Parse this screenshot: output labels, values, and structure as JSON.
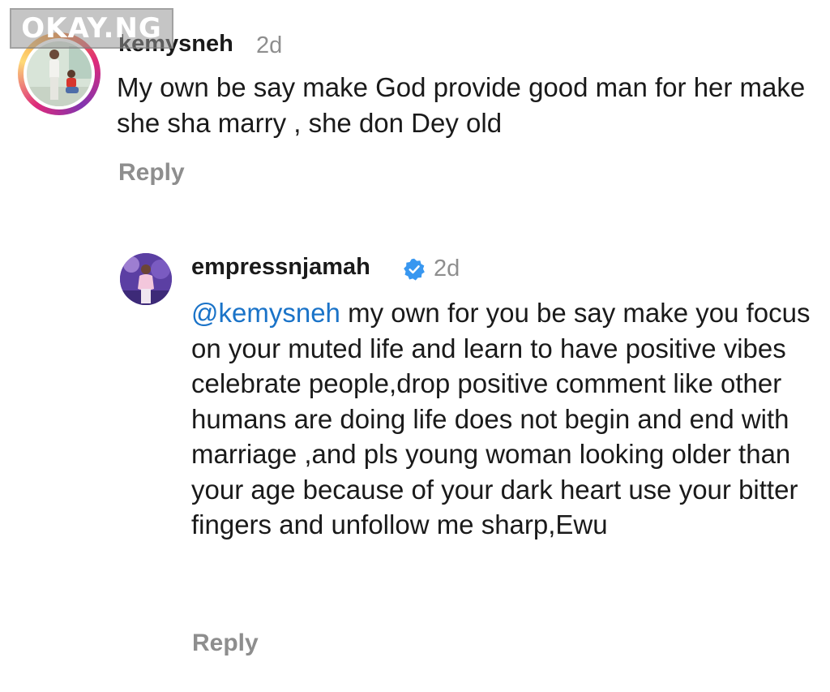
{
  "watermark": {
    "text": "OKAY.NG"
  },
  "comments": [
    {
      "username": "kemysneh",
      "time": "2d",
      "text": "My own be say make God provide good man for her make she sha marry , she don Dey old",
      "reply_label": "Reply"
    },
    {
      "username": "empressnjamah",
      "verified": true,
      "time": "2d",
      "mention": "@kemysneh",
      "text": " my own for you be say make you focus on your muted life and learn to have positive vibes celebrate people,drop positive comment like other humans are doing life does not begin and end with marriage ,and pls young woman looking older than your age because of your dark heart use your bitter fingers and unfollow me sharp,Ewu",
      "reply_label": "Reply"
    }
  ],
  "colors": {
    "text": "#1a1a1a",
    "muted": "#8e8e8e",
    "mention": "#1a73c8",
    "verified": "#3897f0"
  },
  "icons": {
    "verified": "verified-badge-icon"
  }
}
